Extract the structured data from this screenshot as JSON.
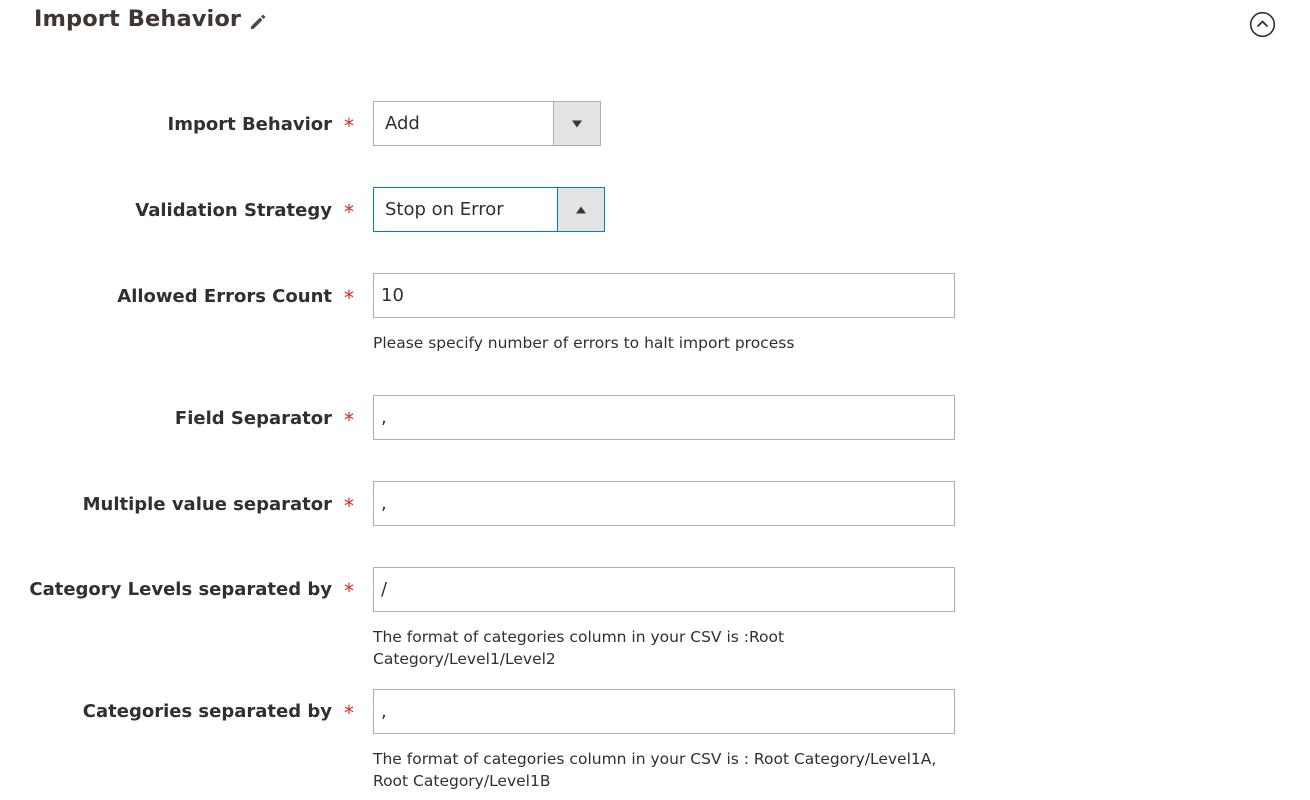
{
  "section": {
    "title": "Import Behavior",
    "edit_icon": "pencil-icon",
    "collapse_icon": "chevron-up-circle-icon"
  },
  "fields": {
    "import_behavior": {
      "label": "Import Behavior",
      "required": "*",
      "value": "Add"
    },
    "validation_strategy": {
      "label": "Validation Strategy",
      "required": "*",
      "value": "Stop on Error"
    },
    "allowed_errors_count": {
      "label": "Allowed Errors Count",
      "required": "*",
      "value": "10",
      "note": "Please specify number of errors to halt import process"
    },
    "field_separator": {
      "label": "Field Separator",
      "required": "*",
      "value": ","
    },
    "multiple_value_separator": {
      "label": "Multiple value separator",
      "required": "*",
      "value": ","
    },
    "category_levels_separator": {
      "label": "Category Levels separated by",
      "required": "*",
      "value": "/",
      "note": "The format of categories column in your CSV is :Root Category/Level1/Level2"
    },
    "categories_separator": {
      "label": "Categories separated by",
      "required": "*",
      "value": ",",
      "note_line1": "The format of categories column in your CSV is : Root Category/Level1A,",
      "note_line2": "Root Category/Level1B"
    }
  },
  "colors": {
    "required_star": "#e22626",
    "focus_border": "#007bdb",
    "input_border": "#adadad",
    "select_button_bg": "#e3e3e3"
  }
}
